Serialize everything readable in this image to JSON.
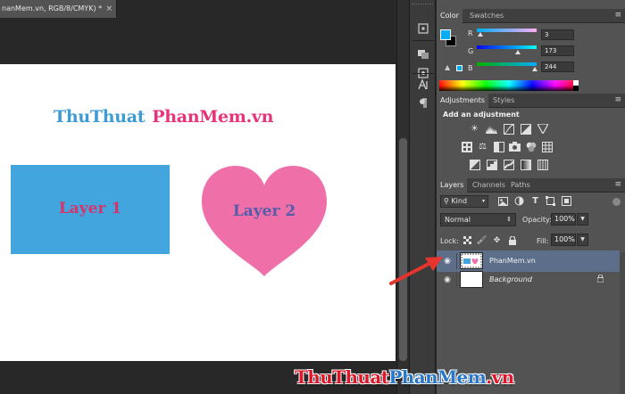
{
  "document": {
    "tab_title": "nanMem.vn, RGB/8/CMYK) *",
    "close_symbol": "×"
  },
  "canvas": {
    "logo_part1": "ThuThuat",
    "logo_part2": "PhanMem.vn",
    "layer1_text": "Layer 1",
    "layer2_text": "Layer 2",
    "colors": {
      "rect": "#42a5de",
      "heart": "#ef6fa8",
      "logo_blue": "#3d9bd6",
      "logo_pink": "#e6337a"
    }
  },
  "color_panel": {
    "tabs": [
      "Color",
      "Swatches"
    ],
    "fg_color": "#03adf4",
    "bg_color": "#000000",
    "channels": [
      {
        "label": "R",
        "value": "3"
      },
      {
        "label": "G",
        "value": "173"
      },
      {
        "label": "B",
        "value": "244"
      }
    ]
  },
  "adjustments_panel": {
    "tabs": [
      "Adjustments",
      "Styles"
    ],
    "title": "Add an adjustment",
    "icons_row1": [
      "brightness-contrast-icon",
      "levels-icon",
      "curves-icon",
      "exposure-icon",
      "gradient-triangle-icon"
    ],
    "icons_row2": [
      "vibrance-icon",
      "balance-icon",
      "black-white-icon",
      "camera-filter-icon",
      "channel-mixer-icon",
      "color-lookup-icon"
    ],
    "icons_row3": [
      "invert-icon",
      "posterize-icon",
      "threshold-icon",
      "gradient-map-icon",
      "selective-color-icon"
    ]
  },
  "layers_panel": {
    "tabs": [
      "Layers",
      "Channels",
      "Paths"
    ],
    "kind_label": "Kind",
    "blend_mode": "Normal",
    "opacity_label": "Opacity:",
    "opacity_value": "100%",
    "lock_label": "Lock:",
    "fill_label": "Fill:",
    "fill_value": "100%",
    "layers": [
      {
        "name": "PhanMem.vn",
        "selected": true
      },
      {
        "name": "Background",
        "selected": false,
        "italic": true,
        "locked": true
      }
    ],
    "selection_color": "#5c6e8a"
  },
  "annotation": {
    "arrow_color": "#e8342e"
  },
  "watermark": {
    "part1": "ThuThuat",
    "part2": "PhanMem",
    "part3": ".vn"
  }
}
